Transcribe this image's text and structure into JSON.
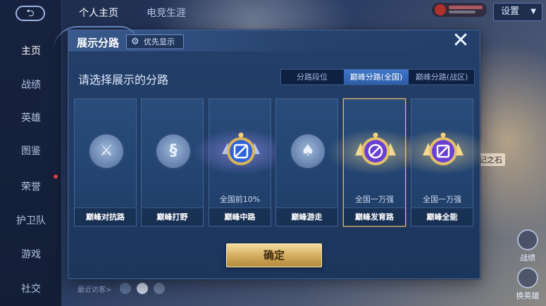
{
  "background": {
    "back_glyph": "⮌",
    "top_tabs": [
      "个人主页",
      "电竞生涯"
    ],
    "settings_label": "设置",
    "side_nav": [
      {
        "label": "主页",
        "active": true
      },
      {
        "label": "战绩"
      },
      {
        "label": "英雄"
      },
      {
        "label": "图鉴"
      },
      {
        "label": "荣誉",
        "badge": true
      },
      {
        "label": "护卫队"
      },
      {
        "label": "游戏"
      },
      {
        "label": "社交"
      }
    ],
    "recent_visitors_label": "最近访客>",
    "right_buttons": [
      "战绩",
      "换英雄"
    ],
    "ghost_label": "记之石"
  },
  "modal": {
    "title": "展示分路",
    "priority_label": "优先显示",
    "close_glyph": "✕",
    "subtitle": "请选择展示的分路",
    "tabs": [
      {
        "label": "分路段位",
        "active": false
      },
      {
        "label": "巅峰分路(全国)",
        "active": true
      },
      {
        "label": "巅峰分路(战区)",
        "active": false
      }
    ],
    "cards": [
      {
        "name": "巅峰对抗路",
        "rank": "",
        "emblem": "plain",
        "icon": "crossed-swords-icon",
        "glyph": "⚔",
        "selected": false
      },
      {
        "name": "巅峰打野",
        "rank": "",
        "emblem": "plain",
        "icon": "dragon-icon",
        "glyph": "§",
        "selected": false
      },
      {
        "name": "巅峰中路",
        "rank": "全国前10%",
        "emblem": "peak",
        "tier": "blue",
        "icon": "mid-lane-peak-icon",
        "selected": false
      },
      {
        "name": "巅峰游走",
        "rank": "",
        "emblem": "plain",
        "icon": "wings-icon",
        "glyph": "♠",
        "selected": false
      },
      {
        "name": "巅峰发育路",
        "rank": "全国一万强",
        "emblem": "peak",
        "tier": "gold",
        "icon": "marksman-peak-icon",
        "selected": true
      },
      {
        "name": "巅峰全能",
        "rank": "全国一万强",
        "emblem": "peak",
        "tier": "gold",
        "icon": "all-round-peak-icon",
        "selected": false
      }
    ],
    "confirm_label": "确定"
  },
  "colors": {
    "gold": "#d5ae5f",
    "selected_border": "#e0b869",
    "tab_active": "#3f77c8",
    "modal_bg": "#1f3a63"
  }
}
